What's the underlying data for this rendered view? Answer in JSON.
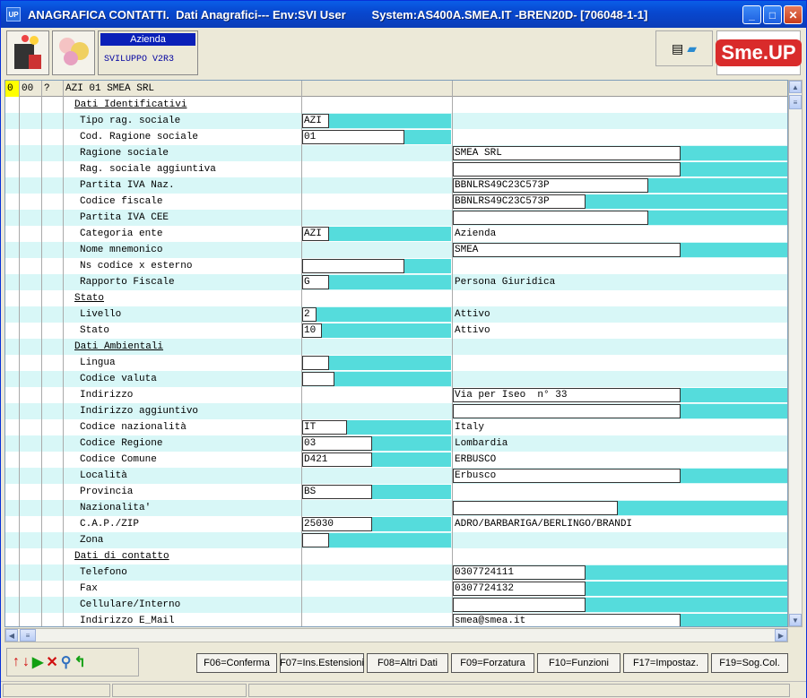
{
  "window": {
    "title": "ANAGRAFICA CONTATTI.  Dati Anagrafici--- Env:SVI User        System:AS400A.SMEA.IT -BREN20D- [706048-1-1]",
    "icon": "UP"
  },
  "env": {
    "label": "Azienda",
    "value": "SVILUPPO V2R3"
  },
  "logo": {
    "text": "Sme.UP"
  },
  "header": {
    "c0": "0",
    "c1": "00",
    "c2": "?",
    "c3": "AZI 01 SMEA SRL"
  },
  "rows": [
    {
      "label": "Dati Identificativi",
      "section": true
    },
    {
      "label": "Tipo rag. sociale",
      "v1": "AZI",
      "v2": ""
    },
    {
      "label": "Cod. Ragione sociale",
      "v1": "01",
      "v2": ""
    },
    {
      "label": "Ragione sociale",
      "v1": "",
      "v2": "SMEA SRL"
    },
    {
      "label": "Rag. sociale aggiuntiva",
      "v1": "",
      "v2": ""
    },
    {
      "label": "Partita IVA Naz.",
      "v1": "",
      "v2": "BBNLRS49C23C573P"
    },
    {
      "label": "Codice fiscale",
      "v1": "",
      "v2": "BBNLRS49C23C573P"
    },
    {
      "label": "Partita IVA CEE",
      "v1": "",
      "v2": ""
    },
    {
      "label": "Categoria ente",
      "v1": "AZI",
      "v2": "Azienda"
    },
    {
      "label": "Nome mnemonico",
      "v1": "",
      "v2": "SMEA"
    },
    {
      "label": "Ns codice x esterno",
      "v1": "",
      "v2": ""
    },
    {
      "label": "Rapporto Fiscale",
      "v1": "G",
      "v2": "Persona Giuridica"
    },
    {
      "label": "Stato",
      "section": true
    },
    {
      "label": "Livello",
      "v1": "2",
      "v2": "Attivo"
    },
    {
      "label": "Stato",
      "v1": "10",
      "v2": "Attivo"
    },
    {
      "label": "Dati Ambientali",
      "section": true
    },
    {
      "label": "Lingua",
      "v1": "",
      "v2": ""
    },
    {
      "label": "Codice valuta",
      "v1": "",
      "v2": ""
    },
    {
      "label": "Indirizzo",
      "v1": "",
      "v2": "Via per Iseo  n° 33"
    },
    {
      "label": "Indirizzo aggiuntivo",
      "v1": "",
      "v2": ""
    },
    {
      "label": "Codice nazionalità",
      "v1": "IT",
      "v2": "Italy"
    },
    {
      "label": "Codice Regione",
      "v1": "03",
      "v2": "Lombardia"
    },
    {
      "label": "Codice Comune",
      "v1": "D421",
      "v2": "ERBUSCO"
    },
    {
      "label": "Località",
      "v1": "",
      "v2": "Erbusco"
    },
    {
      "label": "Provincia",
      "v1": "BS",
      "v2": ""
    },
    {
      "label": "Nazionalita'",
      "v1": "",
      "v2": ""
    },
    {
      "label": "C.A.P./ZIP",
      "v1": "25030",
      "v2": "ADRO/BARBARIGA/BERLINGO/BRANDI"
    },
    {
      "label": "Zona",
      "v1": "",
      "v2": ""
    },
    {
      "label": "Dati di contatto",
      "section": true
    },
    {
      "label": "Telefono",
      "v1": "",
      "v2": "0307724111"
    },
    {
      "label": "Fax",
      "v1": "",
      "v2": "0307724132"
    },
    {
      "label": "Cellulare/Interno",
      "v1": "",
      "v2": ""
    },
    {
      "label": "Indirizzo E_Mail",
      "v1": "",
      "v2": "smea@smea.it"
    }
  ],
  "fkeys": [
    "F06=Conferma",
    "F07=Ins.Estensioni",
    "F08=Altri Dati",
    "F09=Forzatura",
    "F10=Funzioni",
    "F17=Impostaz.",
    "F19=Sog.Col."
  ],
  "colors": {
    "accent": "#55dcdc",
    "rowAlt": "#d8f7f7",
    "titlebar": "#0848d0"
  }
}
